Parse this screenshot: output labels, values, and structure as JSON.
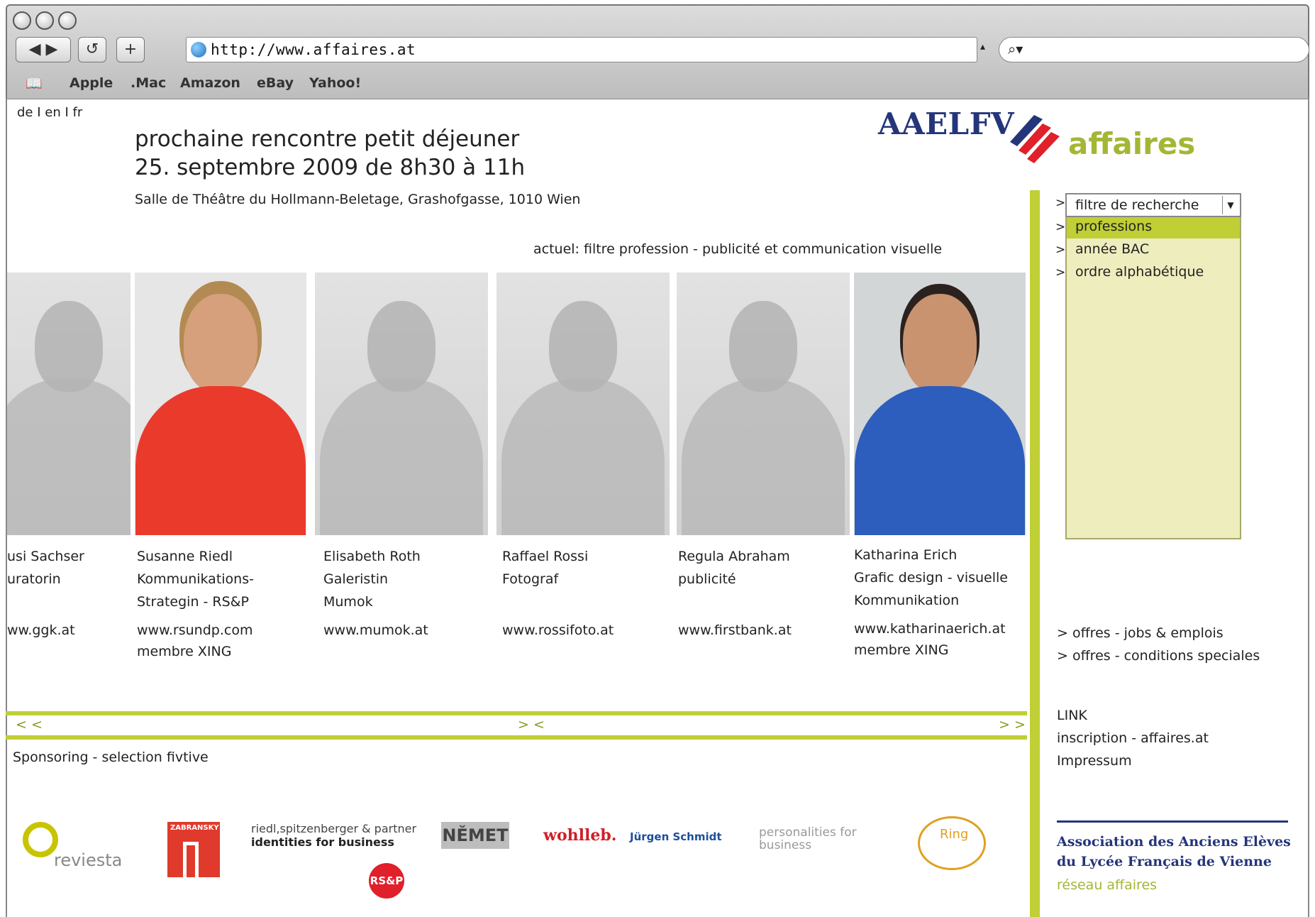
{
  "browser": {
    "url": "http://www.affaires.at",
    "bookmarks": [
      "Apple",
      ".Mac",
      "Amazon",
      "eBay",
      "Yahoo!"
    ]
  },
  "page": {
    "lang_switch": "de I en I fr",
    "headline_1": "prochaine rencontre petit déjeuner",
    "headline_2": "25. septembre 2009 de 8h30 à 11h",
    "venue": "Salle de Théâtre du Hollmann-Beletage, Grashofgasse, 1010 Wien",
    "current_filter": "actuel: filtre profession - publicité et communication visuelle",
    "logo_text_1": "AAELFV",
    "logo_text_2": "affaires"
  },
  "people": [
    {
      "name": "usi Sachser",
      "line2": "uratorin",
      "line3": "",
      "web": "ww.ggk.at",
      "member": ""
    },
    {
      "name": "Susanne Riedl",
      "line2": "Kommunikations-",
      "line3": "Strategin - RS&P",
      "web": "www.rsundp.com",
      "member": "membre XING"
    },
    {
      "name": "Elisabeth Roth",
      "line2": "Galeristin",
      "line3": "Mumok",
      "web": "www.mumok.at",
      "member": ""
    },
    {
      "name": "Raffael Rossi",
      "line2": "Fotograf",
      "line3": "",
      "web": "www.rossifoto.at",
      "member": ""
    },
    {
      "name": "Regula Abraham",
      "line2": "publicité",
      "line3": "",
      "web": "www.firstbank.at",
      "member": ""
    },
    {
      "name": "Katharina Erich",
      "line2": "Grafic design - visuelle",
      "line3": "Kommunikation",
      "web": "www.katharinaerich.at",
      "member": "membre XING"
    }
  ],
  "nav": {
    "prev": "< <",
    "middle": "> <",
    "next": "> >"
  },
  "sponsoring": {
    "title": "Sponsoring - selection fivtive",
    "logos": [
      "reviesta",
      "ZABRANSKY",
      "riedl,spitzenberger & partner",
      "identities for business",
      "NĚMET",
      "wohlleb.",
      "Jürgen Schmidt",
      "personalities for business",
      "Ring",
      "RS&P"
    ]
  },
  "filter": {
    "select_label": "filtre de recherche",
    "options": [
      "professions",
      "année BAC",
      "ordre alphabétique"
    ]
  },
  "sidebar": {
    "offers_1": "> offres - jobs & emplois",
    "offers_2": "> offres - conditions speciales",
    "link_title": "LINK",
    "link_1": "inscription - affaires.at",
    "link_2": "Impressum",
    "assoc_1": "Association des Anciens Elèves",
    "assoc_2": "du Lycée Français de Vienne",
    "network": "réseau affaires"
  }
}
